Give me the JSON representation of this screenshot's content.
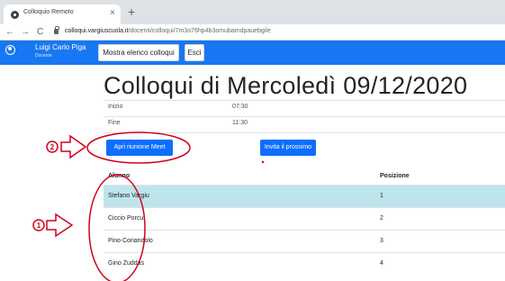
{
  "browser": {
    "tab_title": "Colloquio Remoto",
    "tab_close": "×",
    "new_tab": "+",
    "nav_back": "←",
    "nav_forward": "→",
    "nav_reload": "C",
    "url_host": "colloqui.vargiuscuola.it",
    "url_path": "/docenti/colloqui/7m3o76hp4b3omubamdpauebgile"
  },
  "navbar": {
    "user_name": "Luigi Carlo Piga",
    "user_role": "Docente",
    "list_button": "Mostra elenco colloqui",
    "exit_button": "Esci"
  },
  "page": {
    "title": "Colloqui di Mercoledì 09/12/2020",
    "start_label": "Inizio",
    "start_value": "07:30",
    "end_label": "Fine",
    "end_value": "11:30",
    "meet_button": "Apri riunione Meet",
    "invite_button": "Invita il prossimo"
  },
  "table": {
    "col_student": "Alunno",
    "col_position": "Posizione",
    "rows": [
      {
        "name": "Stefano Vargiu",
        "position": "1"
      },
      {
        "name": "Ciccio Porcu",
        "position": "2"
      },
      {
        "name": "Pino Coriandolo",
        "position": "3"
      },
      {
        "name": "Gino Zuddas",
        "position": "4"
      }
    ]
  },
  "annotations": {
    "marker_1": "1",
    "marker_2": "2"
  },
  "colors": {
    "navbar": "#1877f2",
    "primary_button": "#0d6efd",
    "active_row": "#bee5eb",
    "annotation": "#d0021b"
  }
}
